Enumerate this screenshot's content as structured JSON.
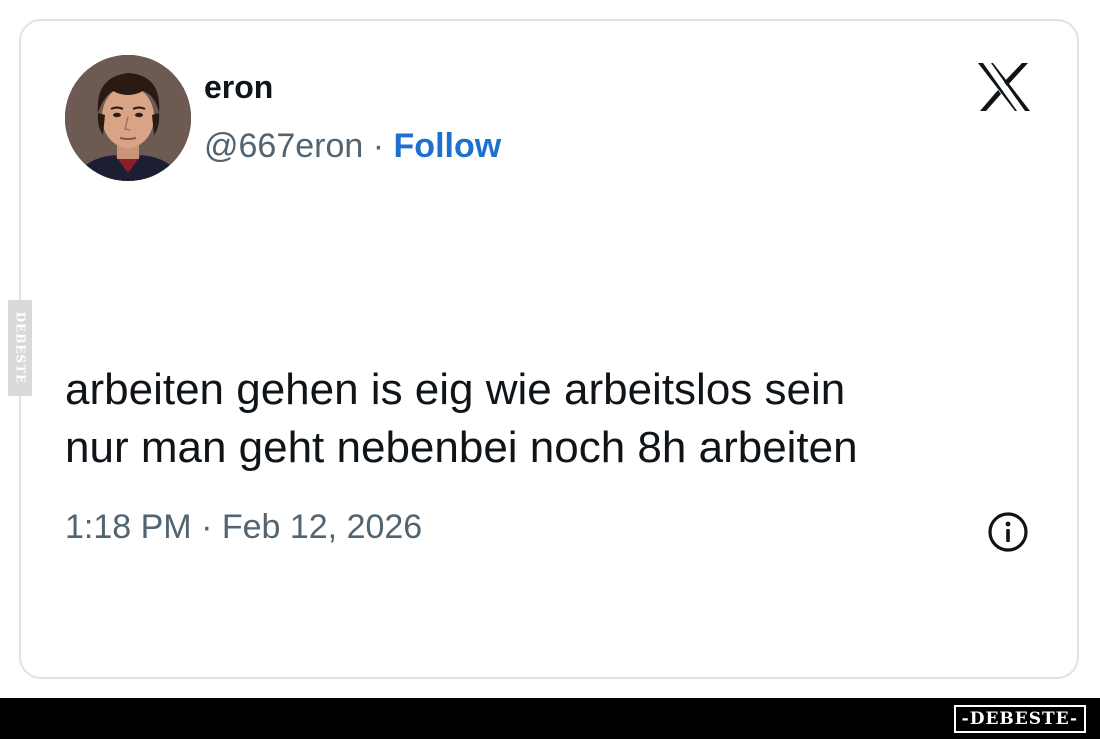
{
  "tweet": {
    "author": {
      "display_name": "eron",
      "handle": "@667eron",
      "separator": "·",
      "follow_label": "Follow"
    },
    "platform_icon": "x-logo-icon",
    "text_lines": [
      "arbeiten gehen is eig wie arbeitslos sein",
      "nur man geht nebenbei noch 8h arbeiten"
    ],
    "timestamp": "1:18 PM · Feb 12, 2026",
    "info_icon": "info-icon"
  },
  "watermark": {
    "side_text": "DEBESTE",
    "footer_brand": "-DEBESTE-"
  },
  "colors": {
    "follow_link": "#1d6fd0",
    "text_primary": "#0f1419",
    "text_secondary": "#536471",
    "card_border": "#dfe3e7",
    "footer_bar": "#000000"
  }
}
